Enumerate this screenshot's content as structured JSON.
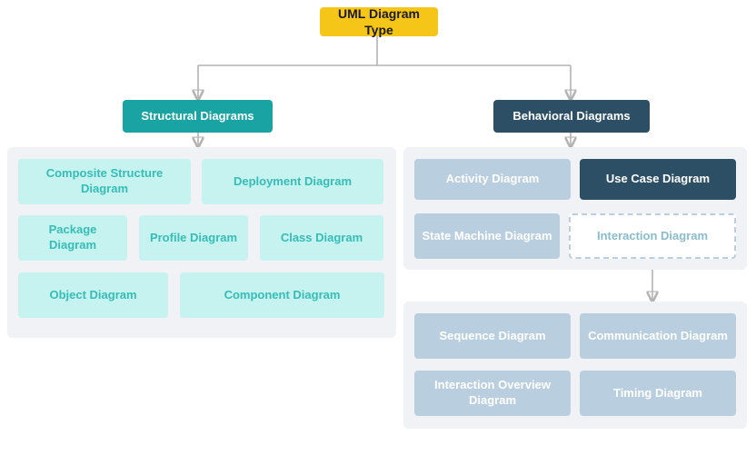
{
  "root": "UML Diagram Type",
  "branches": {
    "structural": {
      "label": "Structural Diagrams",
      "leaves": [
        "Composite Structure Diagram",
        "Deployment Diagram",
        "Package Diagram",
        "Profile Diagram",
        "Class Diagram",
        "Object Diagram",
        "Component Diagram"
      ]
    },
    "behavioral": {
      "label": "Behavioral Diagrams",
      "leaves": [
        "Activity Diagram",
        "Use Case Diagram",
        "State Machine Diagram",
        "Interaction Diagram"
      ],
      "interaction_sub": [
        "Sequence Diagram",
        "Communication Diagram",
        "Interaction Overview Diagram",
        "Timing Diagram"
      ]
    }
  }
}
